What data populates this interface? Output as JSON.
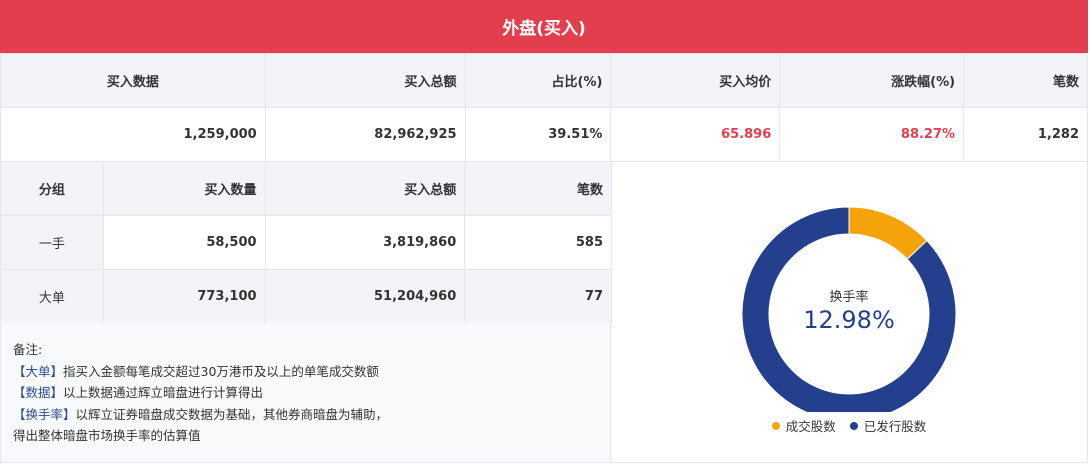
{
  "header": {
    "title": "外盘(买入)"
  },
  "summary": {
    "headers": [
      "买入数据",
      "买入总额",
      "占比(%)",
      "买入均价",
      "涨跌幅(%)",
      "笔数"
    ],
    "values": [
      "1,259,000",
      "82,962,925",
      "39.51%",
      "65.896",
      "88.27%",
      "1,282"
    ]
  },
  "groups": {
    "headers": [
      "分组",
      "买入数量",
      "买入总额",
      "笔数"
    ],
    "rows": [
      [
        "一手",
        "58,500",
        "3,819,860",
        "585"
      ],
      [
        "大单",
        "773,100",
        "51,204,960",
        "77"
      ]
    ]
  },
  "notes": {
    "title": "备注:",
    "lines": [
      {
        "tag": "【大单】",
        "text": "指买入金额每笔成交超过30万港币及以上的单笔成交数额"
      },
      {
        "tag": "【数据】",
        "text": "以上数据通过辉立暗盘进行计算得出"
      },
      {
        "tag": "【换手率】",
        "text": "以辉立证券暗盘成交数据为基础，其他券商暗盘为辅助，"
      }
    ],
    "continuation": "得出整体暗盘市场换手率的估算值"
  },
  "chart_data": {
    "type": "pie",
    "center_label": "换手率",
    "center_value": "12.98%",
    "slices": [
      {
        "name": "成交股数",
        "value": 12.98,
        "color": "#f5a30a"
      },
      {
        "name": "已发行股数",
        "value": 87.02,
        "color": "#243f8e"
      }
    ],
    "legend": "bottom"
  },
  "colors": {
    "accent": "#e33e4d",
    "positive": "#e33e4d",
    "donut_main": "#243f8e",
    "donut_part": "#f5a30a"
  }
}
